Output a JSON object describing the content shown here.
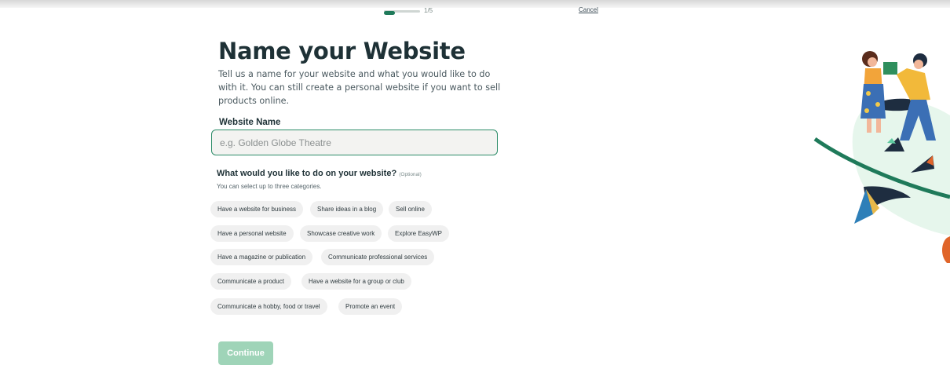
{
  "progress": {
    "text": "1/5",
    "value": 0.2
  },
  "header": {
    "cancel_label": "Cancel"
  },
  "page": {
    "title": "Name your Website",
    "intro": "Tell us a name for your website and what you would like to do with it. You can still create a personal website if you want to sell products online."
  },
  "website_name": {
    "label": "Website Name",
    "placeholder": "e.g. Golden Globe Theatre",
    "value": ""
  },
  "categories": {
    "question": "What would you like to do on your website?",
    "optional_label": "(Optional)",
    "hint": "You can select up to three categories.",
    "chips": [
      "Have a website for business",
      "Share ideas in a blog",
      "Sell online",
      "Have a personal website",
      "Showcase creative work",
      "Explore EasyWP",
      "Have a magazine or publication",
      "Communicate professional services",
      "Communicate a product",
      "Have a website for a group or club",
      "Communicate a hobby, food or travel",
      "Promote an event"
    ]
  },
  "actions": {
    "continue_label": "Continue"
  },
  "colors": {
    "accent": "#2c8c68",
    "progress_fill": "#1f7a5a",
    "continue_disabled": "#9fd4b8",
    "title": "#1e3136"
  }
}
